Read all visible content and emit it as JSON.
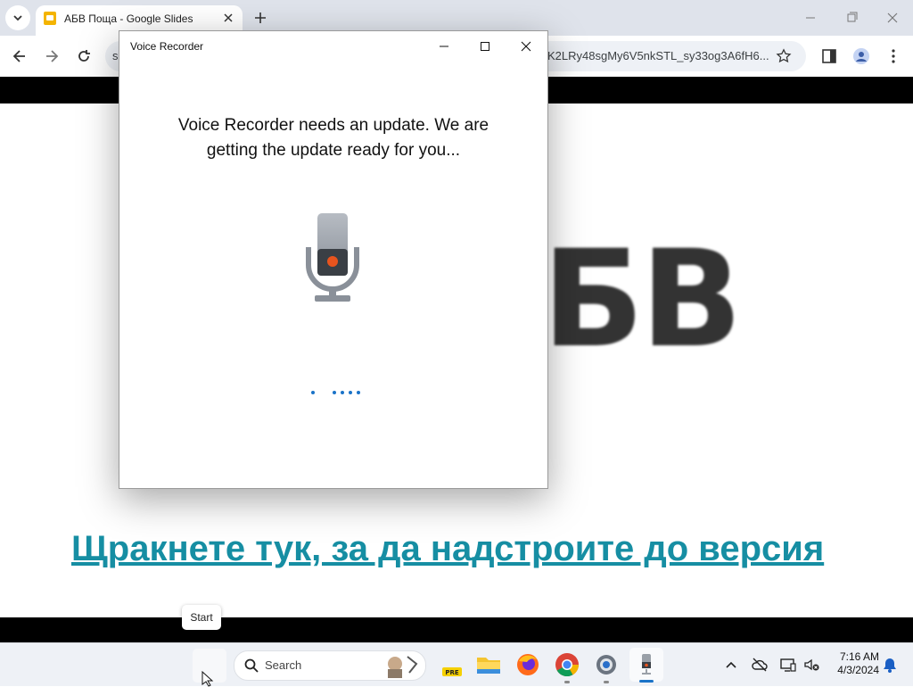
{
  "browser": {
    "tab_title": "АБВ Поща - Google Slides",
    "url_prefix": "s",
    "url": "K2LRy48sgMy6V5nkSTL_sy33og3A6fH6..."
  },
  "slide": {
    "big_text": "БВ",
    "link_text": "Щракнете тук, за да надстроите до версия"
  },
  "dialog": {
    "title": "Voice Recorder",
    "message": "Voice Recorder needs an update. We are getting the update ready for you..."
  },
  "tooltip": {
    "text": "Start"
  },
  "taskbar": {
    "search_placeholder": "Search",
    "time": "7:16 AM",
    "date": "4/3/2024",
    "pre_badge": "PRE"
  },
  "colors": {
    "link": "#168ea3",
    "loading_dots": "#1a73c8",
    "mic_record": "#e8541e"
  },
  "icons": [
    "tab-dropdown-icon",
    "slides-favicon",
    "close-icon",
    "plus-icon",
    "minimize-icon",
    "restore-icon",
    "back-icon",
    "forward-icon",
    "reload-icon",
    "star-icon",
    "side-panel-icon",
    "profile-icon",
    "menu-icon",
    "microphone-icon",
    "search-icon",
    "file-explorer-icon",
    "firefox-icon",
    "chrome-icon",
    "settings-icon",
    "voice-recorder-icon",
    "chevron-up-icon",
    "cloud-off-icon",
    "display-icon",
    "volume-muted-icon",
    "notification-bell-icon"
  ]
}
